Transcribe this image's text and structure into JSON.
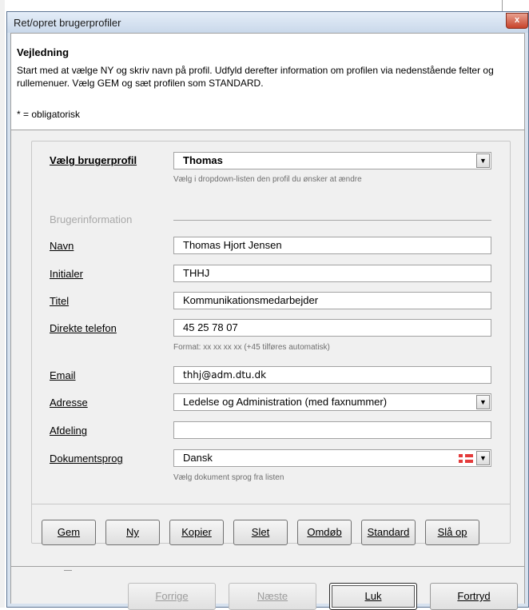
{
  "window": {
    "title": "Ret/opret brugerprofiler",
    "close_label": "x"
  },
  "guidance": {
    "title": "Vejledning",
    "text": "Start med at vælge NY og skriv navn på profil. Udfyld derefter information om profilen via nedenstående felter og rullemenuer. Vælg GEM og sæt profilen som STANDARD.",
    "required_note": "* = obligatorisk"
  },
  "form": {
    "profile_label": "Vælg brugerprofil",
    "profile_value": "Thomas",
    "profile_hint": "Vælg i dropdown-listen den profil du ønsker at ændre",
    "section_label": "Brugerinformation",
    "name_label": "Navn",
    "name_value": "Thomas Hjort Jensen",
    "initials_label": "Initialer",
    "initials_value": "THHJ",
    "title_label": "Titel",
    "title_value": "Kommunikationsmedarbejder",
    "phone_label": "Direkte telefon",
    "phone_value": "45 25 78 07",
    "phone_hint": "Format: xx xx xx xx (+45 tilføres automatisk)",
    "email_label": "Email",
    "email_value": "thhj@adm.dtu.dk",
    "address_label": "Adresse",
    "address_value": "Ledelse og Administration (med faxnummer)",
    "department_label": "Afdeling",
    "department_value": "",
    "language_label": "Dokumentsprog",
    "language_value": "Dansk",
    "language_flag_icon": "danish-flag-icon",
    "language_hint": "Vælg dokument sprog fra listen"
  },
  "actions": {
    "save": "Gem",
    "new": "Ny",
    "copy": "Kopier",
    "delete": "Slet",
    "rename": "Omdøb",
    "standard": "Standard",
    "lookup": "Slå op"
  },
  "footer": {
    "previous": "Forrige",
    "next": "Næste",
    "close": "Luk",
    "cancel": "Fortryd"
  },
  "icons": {
    "dropdown": "chevron-down-icon",
    "close": "close-icon"
  },
  "colors": {
    "title_bar": "#c9d8ea",
    "close_button": "#c7432b",
    "disabled_text": "#9c9c9c"
  }
}
